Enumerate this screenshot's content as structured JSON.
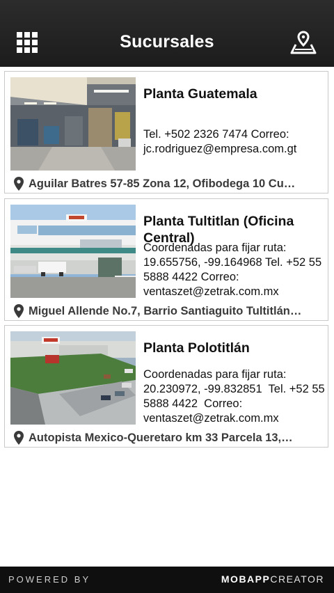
{
  "header": {
    "title": "Sucursales",
    "menu_icon": "grid-menu-icon",
    "map_icon": "map-pin-icon"
  },
  "branches": [
    {
      "name": "Planta Guatemala",
      "description": "Tel. +502 2326 7474 Correo: jc.rodriguez@empresa.com.gt",
      "address": "Aguilar Batres 57-85 Zona 12, Ofibodega 10 Cu…"
    },
    {
      "name": "Planta Tultitlan (Oficina Central)",
      "description": "Coordenadas para fijar ruta: 19.655756, -99.164968 Tel. +52 55 5888 4422 Correo: ventaszet@zetrak.com.mx",
      "address": "Miguel Allende No.7, Barrio Santiaguito Tultitlán…"
    },
    {
      "name": "Planta Polotitlán",
      "description": "Coordenadas para fijar ruta: 20.230972, -99.832851  Tel. +52 55 5888 4422  Correo: ventaszet@zetrak.com.mx",
      "address": "Autopista Mexico-Queretaro km 33 Parcela 13,…"
    }
  ],
  "footer": {
    "powered_by": "POWERED BY",
    "brand_bold": "MOBAPP",
    "brand_light": "CREATOR"
  }
}
